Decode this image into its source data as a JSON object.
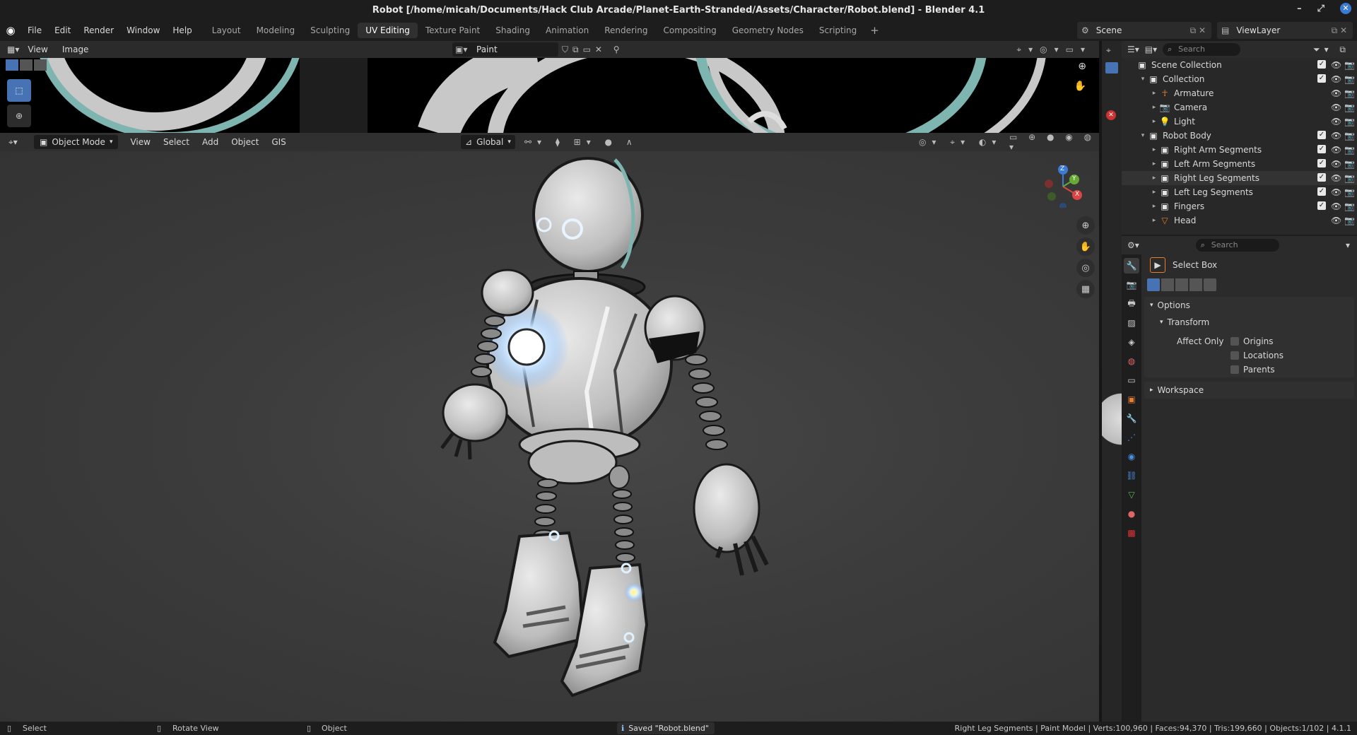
{
  "window": {
    "title": "Robot [/home/micah/Documents/Hack Club Arcade/Planet-Earth-Stranded/Assets/Character/Robot.blend] - Blender 4.1"
  },
  "menu": {
    "file": "File",
    "edit": "Edit",
    "render": "Render",
    "window": "Window",
    "help": "Help"
  },
  "workspaces": [
    "Layout",
    "Modeling",
    "Sculpting",
    "UV Editing",
    "Texture Paint",
    "Shading",
    "Animation",
    "Rendering",
    "Compositing",
    "Geometry Nodes",
    "Scripting"
  ],
  "active_workspace": "UV Editing",
  "scene": {
    "name": "Scene",
    "view_layer": "ViewLayer"
  },
  "uv_editor": {
    "view": "View",
    "image": "Image",
    "image_name": "Paint"
  },
  "viewport": {
    "mode": "Object Mode",
    "menus": [
      "View",
      "Select",
      "Add",
      "Object",
      "GIS"
    ],
    "orientation": "Global",
    "gizmo": {
      "x": "X",
      "y": "Y",
      "z": "Z"
    }
  },
  "outliner": {
    "search_placeholder": "Search",
    "rows": [
      {
        "label": "Scene Collection",
        "indent": 0,
        "icon": "collection-icon"
      },
      {
        "label": "Collection",
        "indent": 1,
        "icon": "collection-icon"
      },
      {
        "label": "Armature",
        "indent": 2,
        "icon": "armature-icon"
      },
      {
        "label": "Camera",
        "indent": 2,
        "icon": "camera-icon"
      },
      {
        "label": "Light",
        "indent": 2,
        "icon": "light-icon"
      },
      {
        "label": "Robot Body",
        "indent": 1,
        "icon": "collection-icon"
      },
      {
        "label": "Right Arm Segments",
        "indent": 2,
        "icon": "collection-icon"
      },
      {
        "label": "Left Arm Segments",
        "indent": 2,
        "icon": "collection-icon"
      },
      {
        "label": "Right Leg Segments",
        "indent": 2,
        "icon": "collection-icon"
      },
      {
        "label": "Left Leg Segments",
        "indent": 2,
        "icon": "collection-icon"
      },
      {
        "label": "Fingers",
        "indent": 2,
        "icon": "collection-icon"
      },
      {
        "label": "Head",
        "indent": 2,
        "icon": "mesh-icon"
      }
    ]
  },
  "properties": {
    "search_placeholder": "Search",
    "tool_name": "Select Box",
    "options_label": "Options",
    "transform_label": "Transform",
    "affect_only_label": "Affect Only",
    "checkboxes": [
      "Origins",
      "Locations",
      "Parents"
    ],
    "workspace_label": "Workspace"
  },
  "statusbar": {
    "select": "Select",
    "rotate_view": "Rotate View",
    "object": "Object",
    "message": "Saved \"Robot.blend\"",
    "stats": "Right Leg Segments | Paint Model | Verts:100,960 | Faces:94,370 | Tris:199,660 | Objects:1/102 | 4.1.1"
  }
}
